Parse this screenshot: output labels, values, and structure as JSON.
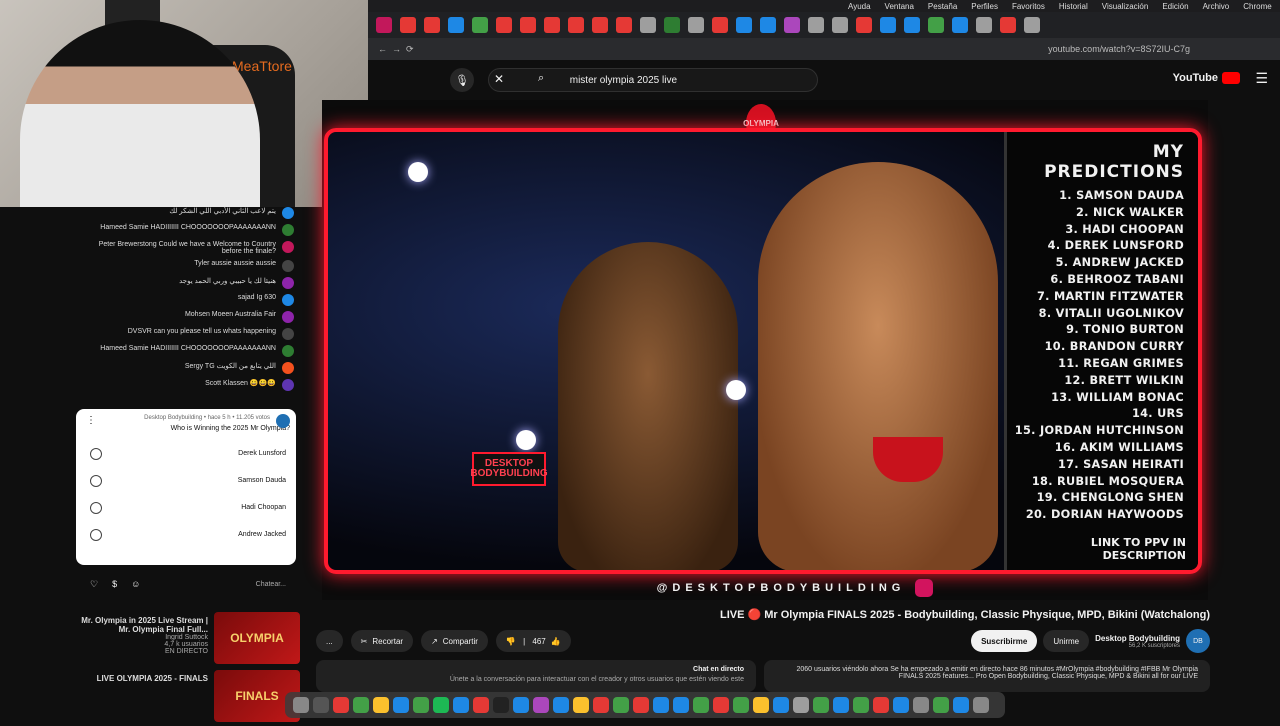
{
  "menubar": {
    "items": [
      "Chrome",
      "Archivo",
      "Edición",
      "Visualización",
      "Historial",
      "Favoritos",
      "Perfiles",
      "Pestaña",
      "Ventana",
      "Ayuda"
    ]
  },
  "tabs": {
    "colors": [
      "#c2185b",
      "#e53935",
      "#e53935",
      "#1e88e5",
      "#43a047",
      "#e53935",
      "#e53935",
      "#e53935",
      "#e53935",
      "#e53935",
      "#e53935",
      "#9e9e9e",
      "#2e7d32",
      "#9e9e9e",
      "#e53935",
      "#1e88e5",
      "#1e88e5",
      "#ab47bc",
      "#9e9e9e",
      "#9e9e9e",
      "#e53935",
      "#1e88e5",
      "#1e88e5",
      "#43a047",
      "#1e88e5",
      "#9e9e9e",
      "#e53935",
      "#9e9e9e"
    ]
  },
  "address": {
    "url": "youtube.com/watch?v=8S72IU-C7g"
  },
  "search": {
    "query": "mister olympia 2025 live"
  },
  "youtube": {
    "logo_text": "YouTube"
  },
  "webcam": {
    "chair_brand": "MeaTtore"
  },
  "chat": {
    "messages": [
      {
        "author": "",
        "text": "يتم لاعب الثاني الأدبي اللي الشكر لك",
        "color": "#1e88e5"
      },
      {
        "author": "Hameed Samie",
        "text": "HADIIIIIII CHOOOOOOOPAAAAAAANN",
        "color": "#2e7d32"
      },
      {
        "author": "Peter Brewerstong",
        "text": "Could we have a Welcome to Country before the finale?",
        "color": "#c2185b"
      },
      {
        "author": "Tyler",
        "text": "aussie aussie aussie",
        "color": "#444"
      },
      {
        "author": "",
        "text": "هنيئا لك يا حبيبي وربي الحمد يوجد",
        "color": "#8e24aa"
      },
      {
        "author": "sajad",
        "text": "Ig 630",
        "color": "#1e88e5"
      },
      {
        "author": "Mohsen Moeen",
        "text": "Australia Fair",
        "color": "#8e24aa"
      },
      {
        "author": "DVSVR",
        "text": "can you please tell us whats happening",
        "color": "#444"
      },
      {
        "author": "Hameed Samie",
        "text": "HADIIIIIII CHOOOOOOOPAAAAAAANN",
        "color": "#2e7d32"
      },
      {
        "author": "Sergy TG",
        "text": "اللي يتابع من الكويت",
        "color": "#f4511e"
      },
      {
        "author": "Scott Klassen",
        "text": "😀😀😀",
        "color": "#5e35b1"
      }
    ],
    "input_placeholder": "Chatear..."
  },
  "poll": {
    "header": "Desktop Bodybuilding • hace 5 h • 11.205 votos",
    "question": "Who is Winning the 2025 Mr Olympia?",
    "options": [
      "Derek Lunsford",
      "Samson Dauda",
      "Hadi Choopan",
      "Andrew Jacked"
    ]
  },
  "related": [
    {
      "title": "Mr. Olympia in 2025 Live Stream | Mr. Olympia Final Full...",
      "channel": "Ingrid Suttock",
      "views": "4,7 k usuarios",
      "thumb": "OLYMPIA",
      "badge": "EN DIRECTO"
    },
    {
      "title": "LIVE OLYMPIA 2025 - FINALS",
      "channel": "",
      "views": "",
      "thumb": "FINALS",
      "badge": ""
    }
  ],
  "video": {
    "predictions_title": "MY PREDICTIONS",
    "predictions": [
      "1. SAMSON DAUDA",
      "2. NICK WALKER",
      "3. HADI CHOOPAN",
      "4. DEREK LUNSFORD",
      "5. ANDREW JACKED",
      "6. BEHROOZ TABANI",
      "7. MARTIN FITZWATER",
      "8. VITALII UGOLNIKOV",
      "9. TONIO BURTON",
      "10. BRANDON CURRY",
      "11. REGAN GRIMES",
      "12. BRETT WILKIN",
      "13. WILLIAM BONAC",
      "14. URS",
      "15. JORDAN HUTCHINSON",
      "16. AKIM WILLIAMS",
      "17. SASAN HEIRATI",
      "18. RUBIEL MOSQUERA",
      "19. CHENGLONG SHEN",
      "20. DORIAN HAYWOODS"
    ],
    "predictions_link": "LINK TO PPV IN DESCRIPTION",
    "brand": "@DESKTOPBODYBUILDING",
    "stage_sign": "DESKTOP BODYBUILDING",
    "emblem": "OLYMPIA"
  },
  "title": "LIVE 🔴 Mr Olympia FINALS 2025 - Bodybuilding, Classic Physique, MPD, Bikini (Watchalong)",
  "channel": {
    "name": "Desktop Bodybuilding",
    "subs": "56,2 K suscriptores",
    "join": "Unirme",
    "subscribe": "Suscribirme",
    "avatar": "DB"
  },
  "actions": {
    "likes": "467",
    "share": "Compartir",
    "clip": "Recortar",
    "more": "..."
  },
  "chat_direct": {
    "title": "Chat en directo",
    "text": "Únete a la conversación para interactuar con el creador y otros usuarios que estén viendo este"
  },
  "description": {
    "text": "2060 usuarios viéndolo ahora  Se ha empezado a emitir en directo hace 86 minutos  #MrOlympia #bodybuilding #IFBB Mr Olympia FINALS 2025 features... Pro Open Bodybuilding, Classic Physique, MPD & Bikini all for our LIVE"
  },
  "dock": {
    "colors": [
      "#888",
      "#555",
      "#e53935",
      "#43a047",
      "#fbc02d",
      "#1e88e5",
      "#43a047",
      "#1db954",
      "#1e88e5",
      "#e53935",
      "#222",
      "#1e88e5",
      "#ab47bc",
      "#1e88e5",
      "#fbc02d",
      "#e53935",
      "#43a047",
      "#e53935",
      "#1e88e5",
      "#1e88e5",
      "#43a047",
      "#e53935",
      "#43a047",
      "#fbc02d",
      "#1e88e5",
      "#9e9e9e",
      "#43a047",
      "#1e88e5",
      "#43a047",
      "#e53935",
      "#1e88e5",
      "#888",
      "#43a047",
      "#1e88e5",
      "#888"
    ]
  }
}
